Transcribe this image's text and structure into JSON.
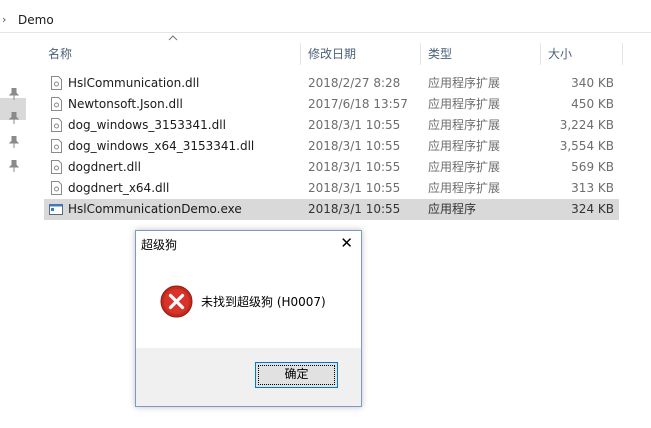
{
  "breadcrumb": {
    "arrow": "›",
    "folder": "Demo"
  },
  "columns": {
    "name": "名称",
    "date": "修改日期",
    "type": "类型",
    "size": "大小"
  },
  "files": [
    {
      "name": "HslCommunication.dll",
      "date": "2018/2/27 8:28",
      "type": "应用程序扩展",
      "size": "340 KB"
    },
    {
      "name": "Newtonsoft.Json.dll",
      "date": "2017/6/18 13:57",
      "type": "应用程序扩展",
      "size": "450 KB"
    },
    {
      "name": "dog_windows_3153341.dll",
      "date": "2018/3/1 10:55",
      "type": "应用程序扩展",
      "size": "3,224 KB"
    },
    {
      "name": "dog_windows_x64_3153341.dll",
      "date": "2018/3/1 10:55",
      "type": "应用程序扩展",
      "size": "3,554 KB"
    },
    {
      "name": "dogdnert.dll",
      "date": "2018/3/1 10:55",
      "type": "应用程序扩展",
      "size": "569 KB"
    },
    {
      "name": "dogdnert_x64.dll",
      "date": "2018/3/1 10:55",
      "type": "应用程序扩展",
      "size": "313 KB"
    },
    {
      "name": "HslCommunicationDemo.exe",
      "date": "2018/3/1 10:55",
      "type": "应用程序",
      "size": "324 KB"
    }
  ],
  "dialog": {
    "title": "超级狗",
    "close": "✕",
    "message": "未找到超级狗 (H0007)",
    "ok_label": "确定"
  },
  "colors": {
    "selection": "#d9d9d9",
    "header_text": "#4c607a",
    "error_red": "#c42b1c",
    "button_border": "#0078d7"
  }
}
